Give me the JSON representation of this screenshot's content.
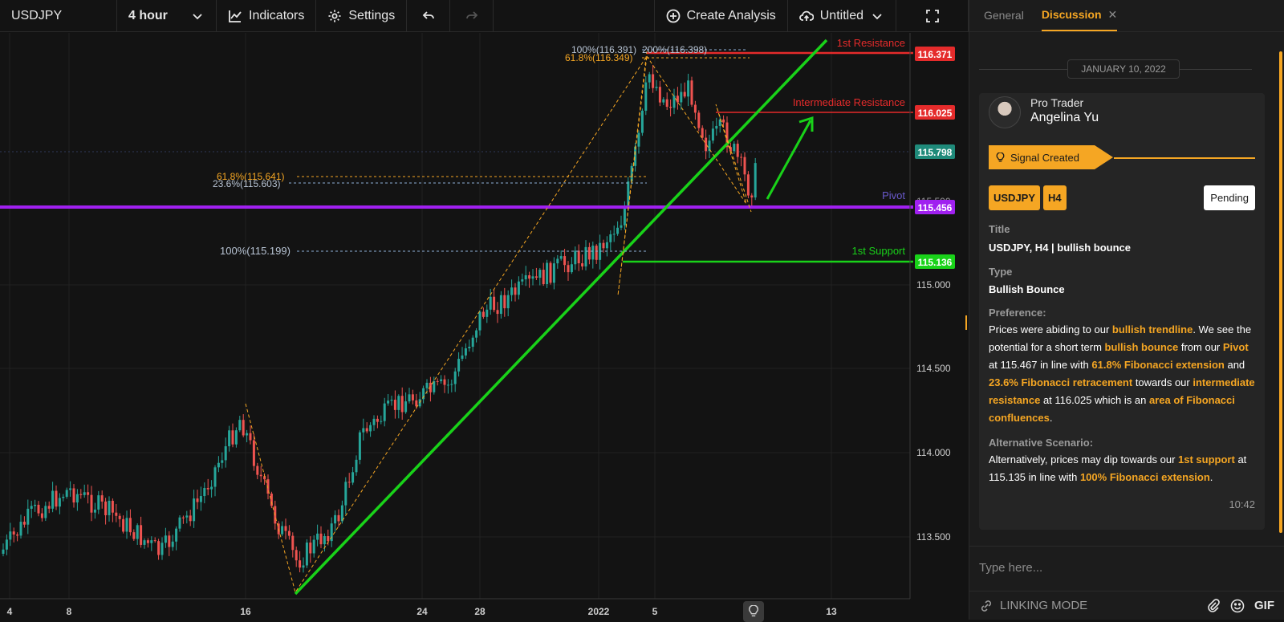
{
  "toolbar": {
    "symbol": "USDJPY",
    "timeframe": "4 hour",
    "indicators": "Indicators",
    "settings": "Settings",
    "create_analysis": "Create Analysis",
    "layout_name": "Untitled"
  },
  "chart": {
    "price_scale": [
      "115.000",
      "114.500",
      "114.000",
      "113.500"
    ],
    "time_scale": [
      "4",
      "8",
      "16",
      "24",
      "28",
      "2022",
      "5",
      "13"
    ],
    "price_labels": [
      {
        "text": "116.371",
        "color": "#e52b2b"
      },
      {
        "text": "116.025",
        "color": "#e52b2b"
      },
      {
        "text": "115.798",
        "color": "#1f8a7a"
      },
      {
        "text": "115.456",
        "color": "#a020f0"
      },
      {
        "text": "115.136",
        "color": "#19d219"
      }
    ],
    "line_labels": {
      "resistance1": "1st Resistance",
      "intermediate": "Intermediate Resistance",
      "pivot": "Pivot",
      "support1": "1st Support"
    },
    "fib_labels": {
      "top_100": "100%(116.391)",
      "top_200": "200%(116.398)",
      "top_618": "61.8%(116.349)",
      "mid_618": "61.8%(115.641)",
      "mid_236": "23.6%(115.603)",
      "low_100": "100%(115.199)"
    },
    "hidden_ticks": [
      "115.500"
    ]
  },
  "sidebar": {
    "tabs": [
      {
        "label": "General"
      },
      {
        "label": "Discussion"
      }
    ],
    "date": "JANUARY 10, 2022",
    "author_role": "Pro Trader",
    "author_name": "Angelina Yu",
    "signal": "Signal Created",
    "chips": [
      "USDJPY",
      "H4"
    ],
    "status": "Pending",
    "title_label": "Title",
    "title_value": "USDJPY, H4 | bullish bounce",
    "type_label": "Type",
    "type_value": "Bullish Bounce",
    "preference_label": "Preference:",
    "preference_parts": [
      {
        "t": "Prices were abiding to our ",
        "h": false
      },
      {
        "t": "bullish trendline",
        "h": true
      },
      {
        "t": ". We see the potential for a short term ",
        "h": false
      },
      {
        "t": "bullish bounce",
        "h": true
      },
      {
        "t": " from our ",
        "h": false
      },
      {
        "t": "Pivot",
        "h": true
      },
      {
        "t": " at 115.467 in line with ",
        "h": false
      },
      {
        "t": "61.8% Fibonacci extension",
        "h": true
      },
      {
        "t": " and ",
        "h": false
      },
      {
        "t": "23.6% Fibonacci retracement",
        "h": true
      },
      {
        "t": " towards our ",
        "h": false
      },
      {
        "t": "intermediate resistance",
        "h": true
      },
      {
        "t": " at 116.025 which is an ",
        "h": false
      },
      {
        "t": "area of Fibonacci confluences",
        "h": true
      },
      {
        "t": ".",
        "h": false
      }
    ],
    "alt_label": "Alternative Scenario:",
    "alt_parts": [
      {
        "t": "Alternatively, prices may dip towards our ",
        "h": false
      },
      {
        "t": "1st support",
        "h": true
      },
      {
        "t": " at 115.135 in line with ",
        "h": false
      },
      {
        "t": "100% Fibonacci extension",
        "h": true
      },
      {
        "t": ".",
        "h": false
      }
    ],
    "time": "10:42",
    "input_placeholder": "Type here...",
    "linking_mode": "LINKING MODE",
    "gif": "GIF"
  },
  "colors": {
    "accent": "#f5a623",
    "resistance": "#e52b2b",
    "support": "#19d219",
    "pivot": "#a020f0",
    "trend": "#19d219"
  }
}
